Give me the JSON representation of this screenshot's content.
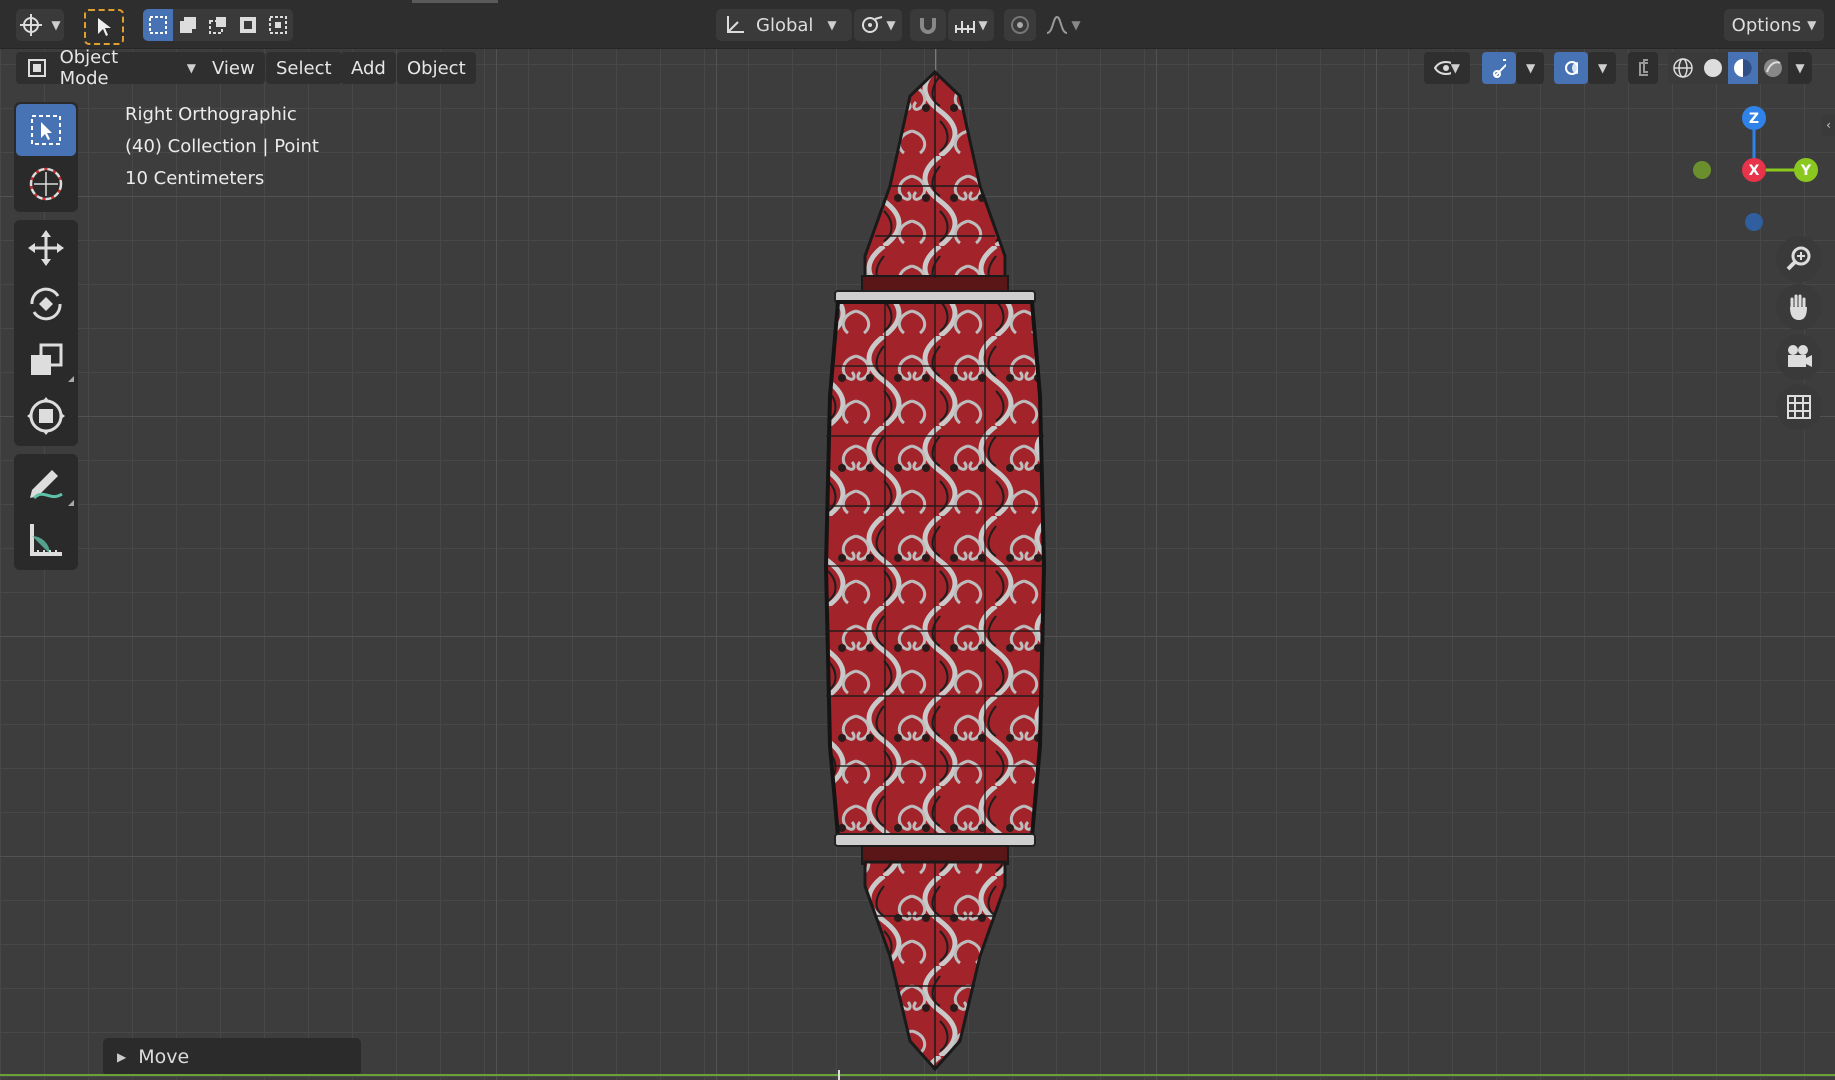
{
  "header": {
    "transform_orientation": "Global",
    "options_label": "Options"
  },
  "menubar": {
    "mode_label": "Object Mode",
    "menus": [
      "View",
      "Select",
      "Add",
      "Object"
    ]
  },
  "viewport_info": {
    "view_name": "Right Orthographic",
    "collection_line": "(40) Collection | Point",
    "grid_scale": "10 Centimeters"
  },
  "gizmo": {
    "z_label": "Z",
    "x_label": "X",
    "y_label": "Y",
    "z_color": "#2f83e8",
    "x_color": "#e8344a",
    "y_color": "#8bc81f"
  },
  "toolbar": {
    "tools": [
      "select-box",
      "cursor",
      "move",
      "rotate",
      "scale",
      "transform",
      "annotate",
      "measure"
    ],
    "active_tool": "select-box"
  },
  "operator_panel": {
    "label": "Move"
  },
  "colors": {
    "accent": "#4772b3",
    "background": "#3d3d3d",
    "object_red": "#b8262b"
  }
}
